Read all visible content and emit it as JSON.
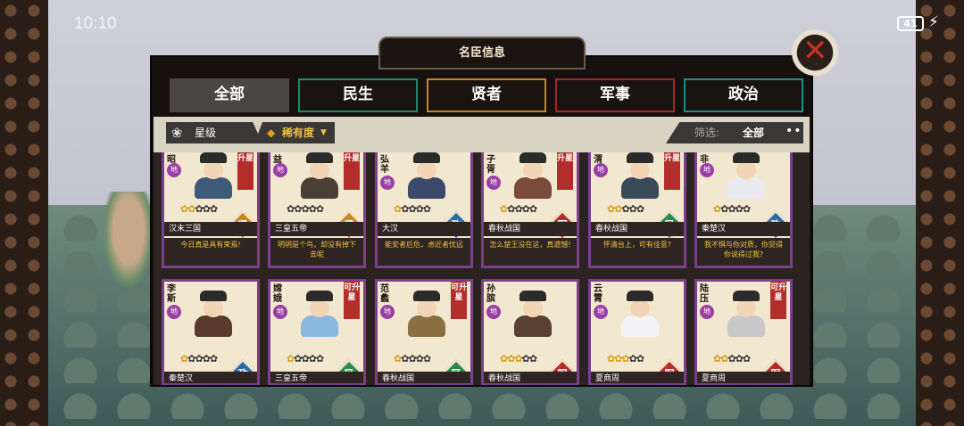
{
  "status": {
    "time": "10:10",
    "battery": "41"
  },
  "panel": {
    "title": "名臣信息",
    "close_icon": "close-x-icon",
    "tabs": [
      {
        "label": "全部",
        "active": true,
        "color": "#4a4642"
      },
      {
        "label": "民生",
        "active": false,
        "color": "#1f8a6a"
      },
      {
        "label": "贤者",
        "active": false,
        "color": "#c9861e"
      },
      {
        "label": "军事",
        "active": false,
        "color": "#a3262c"
      },
      {
        "label": "政治",
        "active": false,
        "color": "#1f8a8a"
      }
    ],
    "filters": {
      "star_label": "星级",
      "rarity_label": "稀有度",
      "screen_label": "筛选:",
      "screen_value": "全部"
    }
  },
  "cards_row1": [
    {
      "name": "昭",
      "tier": "地",
      "upgrade": "升星",
      "stars": 2,
      "type": "贤",
      "type_color": "#c9861e",
      "era": "汉末三国",
      "quote": "今日真是具有荣焉!",
      "robe": "#3e5a7a"
    },
    {
      "name": "益",
      "tier": "地",
      "upgrade": "升星",
      "stars": 0,
      "type": "贤",
      "type_color": "#c9861e",
      "era": "三皇五帝",
      "quote": "明明是个鸟，却没有掉下去呢",
      "robe": "#4a4038"
    },
    {
      "name": "弘羊",
      "tier": "地",
      "upgrade": "",
      "stars": 1,
      "type": "政",
      "type_color": "#2a6aa6",
      "era": "大汉",
      "quote": "能安者后危，虑近者忧远",
      "robe": "#3b4a6a"
    },
    {
      "name": "子胥",
      "tier": "地",
      "upgrade": "升星",
      "stars": 1,
      "type": "军",
      "type_color": "#b32e2a",
      "era": "春秋战国",
      "quote": "怎么楚王没在这，真遗憾!",
      "robe": "#7a4a3a"
    },
    {
      "name": "渭",
      "tier": "地",
      "upgrade": "升星",
      "stars": 2,
      "type": "民",
      "type_color": "#2e8a4a",
      "era": "春秋战国",
      "quote": "怀清台上，可有佳意?",
      "robe": "#3a4a5a"
    },
    {
      "name": "非",
      "tier": "地",
      "upgrade": "",
      "stars": 1,
      "type": "政",
      "type_color": "#2a6aa6",
      "era": "秦楚汉",
      "quote": "我不惧与你对质，你觉得你说得过我?",
      "robe": "#e9e9ef"
    }
  ],
  "cards_row2": [
    {
      "name": "李斯",
      "tier": "地",
      "upgrade": "",
      "stars": 1,
      "type": "政",
      "type_color": "#2a6aa6",
      "era": "秦楚汉",
      "robe": "#5a3a2a"
    },
    {
      "name": "嫦娥",
      "tier": "地",
      "upgrade": "可升星",
      "stars": 1,
      "type": "民",
      "type_color": "#2e8a4a",
      "era": "三皇五帝",
      "robe": "#8ab8e0"
    },
    {
      "name": "范蠡",
      "tier": "地",
      "upgrade": "可升星",
      "stars": 1,
      "type": "民",
      "type_color": "#2e8a4a",
      "era": "春秋战国",
      "robe": "#8a7040"
    },
    {
      "name": "孙膑",
      "tier": "地",
      "upgrade": "",
      "stars": 3,
      "type": "军",
      "type_color": "#b32e2a",
      "era": "春秋战国",
      "robe": "#5a4030"
    },
    {
      "name": "云霄",
      "tier": "地",
      "upgrade": "",
      "stars": 3,
      "type": "军",
      "type_color": "#b32e2a",
      "era": "夏商周",
      "robe": "#f4f4f8"
    },
    {
      "name": "陆压",
      "tier": "地",
      "upgrade": "可升星",
      "stars": 2,
      "type": "军",
      "type_color": "#b32e2a",
      "era": "夏商周",
      "robe": "#c8c8c8"
    }
  ]
}
